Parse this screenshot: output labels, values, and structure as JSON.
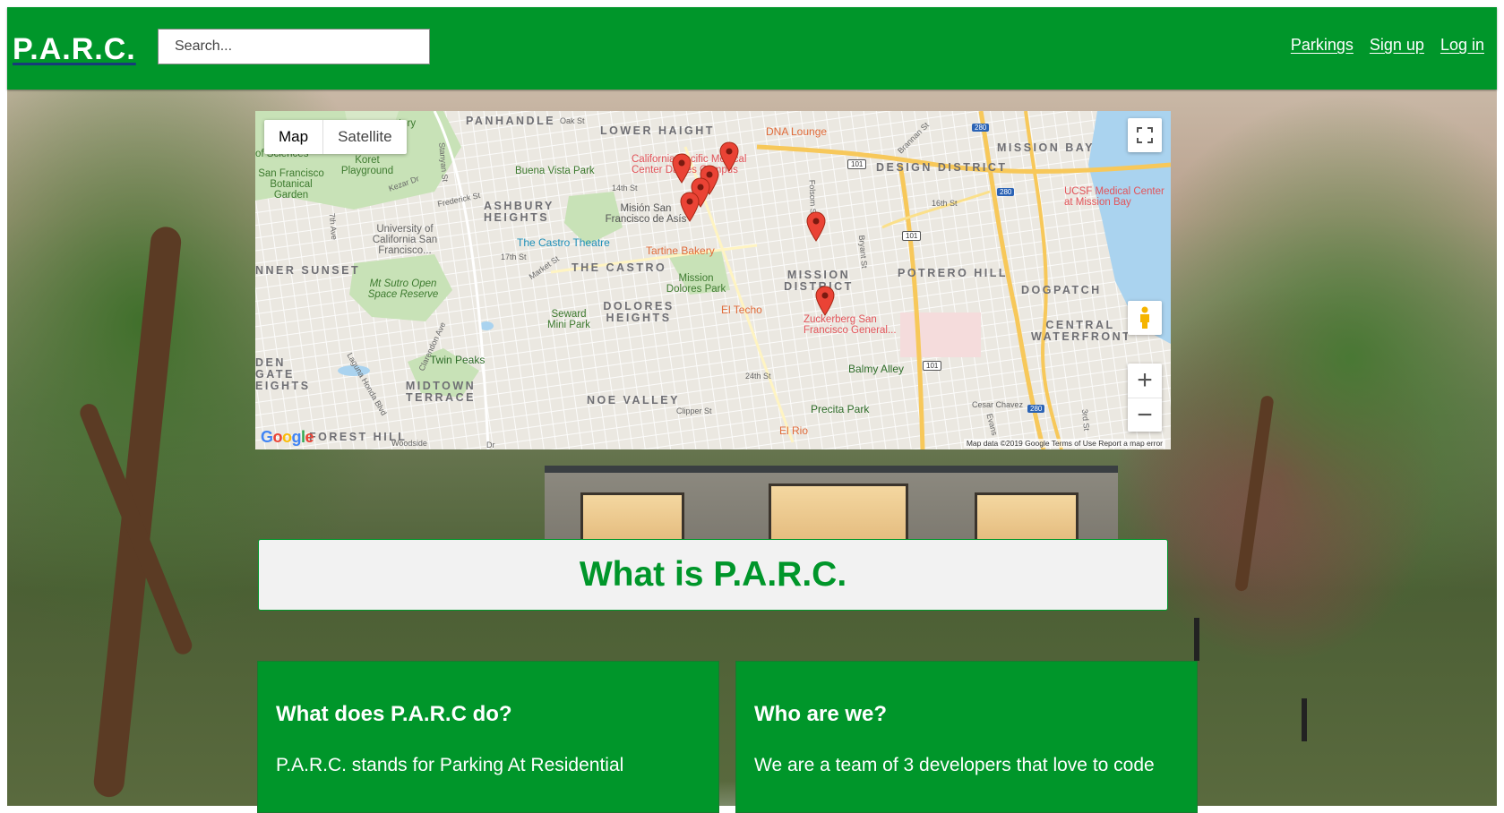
{
  "header": {
    "logo": "P.A.R.C.",
    "search_placeholder": "Search...",
    "nav": [
      "Parkings",
      "Sign up",
      "Log in"
    ]
  },
  "map": {
    "type_buttons": [
      "Map",
      "Satellite"
    ],
    "zoom_in": "+",
    "zoom_out": "−",
    "areas": [
      "PANHANDLE",
      "LOWER HAIGHT",
      "MISSION BAY",
      "DESIGN DISTRICT",
      "ASHBURY HEIGHTS",
      "NNER SUNSET",
      "THE CASTRO",
      "MISSION DISTRICT",
      "POTRERO HILL",
      "DOGPATCH",
      "DOLORES HEIGHTS",
      "CENTRAL WATERFRONT",
      "DEN GATE EIGHTS",
      "MIDTOWN TERRACE",
      "NOE VALLEY",
      "FOREST HILL"
    ],
    "places": {
      "koret": "Koret Playground",
      "botanical": "San Francisco Botanical Garden",
      "buena": "Buena Vista Park",
      "ucsf_sf": "University of California San Francisco...",
      "cpmc": "California Pacific Medical Center Davies Campus",
      "dna": "DNA Lounge",
      "ucsf_mb": "UCSF Medical Center at Mission Bay",
      "mision": "Misión San Francisco de Asís",
      "castro_theatre": "The Castro Theatre",
      "tartine": "Tartine Bakery",
      "sutro": "Mt Sutro Open Space Reserve",
      "seward": "Seward Mini Park",
      "mission_dolores": "Mission Dolores Park",
      "el_techo": "El Techo",
      "zuckerberg": "Zuckerberg San Francisco General...",
      "twin_peaks": "Twin Peaks",
      "balmy": "Balmy Alley",
      "precita": "Precita Park",
      "el_rio": "El Rio",
      "sciences": "of Sciences",
      "tory": "tory"
    },
    "streets": [
      "Oak St",
      "Stanyan St",
      "Kezar Dr",
      "Frederick St",
      "14th St",
      "16th St",
      "17th St",
      "Market St",
      "7th Ave",
      "Folsom St",
      "Bryant St",
      "Clarendon Ave",
      "Laguna Honda Blvd",
      "24th St",
      "Clipper St",
      "Cesar Chavez",
      "Evans",
      "3rd St",
      "Brannan St",
      "Woodside",
      "Dr"
    ],
    "highways": [
      "280",
      "101"
    ],
    "google": "Google",
    "footer": "Map data ©2019 Google   Terms of Use   Report a map error"
  },
  "about": {
    "title": "What is P.A.R.C."
  },
  "cards": [
    {
      "title": "What does P.A.R.C do?",
      "body": "P.A.R.C. stands for Parking At Residential"
    },
    {
      "title": "Who are we?",
      "body": "We are a team of 3 developers that love to code"
    }
  ]
}
